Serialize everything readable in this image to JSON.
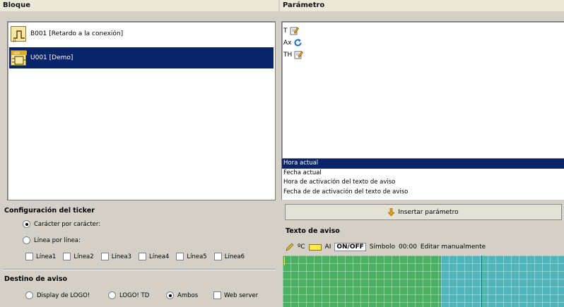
{
  "left": {
    "bloque_header": "Bloque",
    "blocks": [
      {
        "label": "B001 [Retardo a la conexión]",
        "icon": "timer-block-icon",
        "selected": false
      },
      {
        "label": "U001 [Demo]",
        "icon": "udf-block-icon",
        "selected": true
      }
    ],
    "ticker": {
      "title": "Configuración del ticker",
      "opt_char": "Carácter por carácter:",
      "opt_line": "Línea por línea:",
      "selected": "char",
      "lines": [
        "Línea1",
        "Línea2",
        "Línea3",
        "Línea4",
        "Línea5",
        "Línea6"
      ]
    },
    "destino": {
      "title": "Destino de aviso",
      "opt_display": "Display de LOGO!",
      "opt_td": "LOGO! TD",
      "opt_ambos": "Ambos",
      "opt_web": "Web server",
      "selected": "ambos"
    }
  },
  "right": {
    "param_header": "Parámetro",
    "params": [
      {
        "label": "T",
        "icon": "edit-pencil-icon"
      },
      {
        "label": "Ax",
        "icon": "refresh-icon"
      },
      {
        "label": "TH",
        "icon": "edit-pencil-icon"
      }
    ],
    "text_options": [
      {
        "label": "Hora actual",
        "selected": true
      },
      {
        "label": "Fecha actual",
        "selected": false
      },
      {
        "label": "Hora de activación del texto de aviso",
        "selected": false
      },
      {
        "label": "Fecha de de activación del texto de aviso",
        "selected": false
      }
    ],
    "insert_button": "Insertar parámetro",
    "texto_header": "Texto de aviso",
    "toolbar": {
      "degree": "ºC",
      "ai": "AI",
      "onoff": "ON/OFF",
      "simbolo": "Símbolo",
      "time": "00:00",
      "editar": "Editar manualmente"
    }
  },
  "colors": {
    "selection": "#0a246a",
    "grid_green": "#4caf63",
    "grid_teal": "#4fb5b8",
    "cursor_line": "#c0392b"
  }
}
